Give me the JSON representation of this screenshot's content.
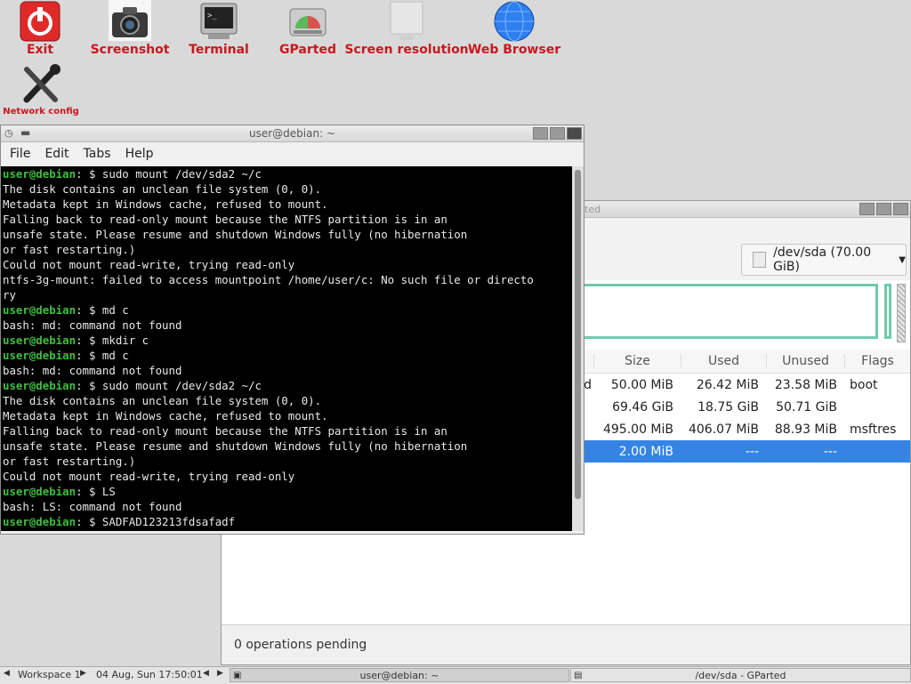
{
  "desktop": {
    "icons": [
      {
        "label": "Exit"
      },
      {
        "label": "Screenshot"
      },
      {
        "label": "Terminal"
      },
      {
        "label": "GParted"
      },
      {
        "label": "Screen resolution"
      },
      {
        "label": "Web Browser"
      },
      {
        "label": "Network config"
      }
    ]
  },
  "terminal": {
    "title": "user@debian: ~",
    "menu": [
      "File",
      "Edit",
      "Tabs",
      "Help"
    ],
    "prompt_user": "user@debian",
    "prompt_tail": ": $ ",
    "lines": [
      {
        "type": "cmd",
        "text": "sudo mount /dev/sda2 ~/c"
      },
      {
        "type": "out",
        "text": "The disk contains an unclean file system (0, 0)."
      },
      {
        "type": "out",
        "text": "Metadata kept in Windows cache, refused to mount."
      },
      {
        "type": "out",
        "text": "Falling back to read-only mount because the NTFS partition is in an"
      },
      {
        "type": "out",
        "text": "unsafe state. Please resume and shutdown Windows fully (no hibernation"
      },
      {
        "type": "out",
        "text": "or fast restarting.)"
      },
      {
        "type": "out",
        "text": "Could not mount read-write, trying read-only"
      },
      {
        "type": "out",
        "text": "ntfs-3g-mount: failed to access mountpoint /home/user/c: No such file or directo"
      },
      {
        "type": "out",
        "text": "ry"
      },
      {
        "type": "cmd",
        "text": "md c"
      },
      {
        "type": "out",
        "text": "bash: md: command not found"
      },
      {
        "type": "cmd",
        "text": "mkdir c"
      },
      {
        "type": "cmd",
        "text": "md c"
      },
      {
        "type": "out",
        "text": "bash: md: command not found"
      },
      {
        "type": "cmd",
        "text": "sudo mount /dev/sda2 ~/c"
      },
      {
        "type": "out",
        "text": "The disk contains an unclean file system (0, 0)."
      },
      {
        "type": "out",
        "text": "Metadata kept in Windows cache, refused to mount."
      },
      {
        "type": "out",
        "text": "Falling back to read-only mount because the NTFS partition is in an"
      },
      {
        "type": "out",
        "text": "unsafe state. Please resume and shutdown Windows fully (no hibernation"
      },
      {
        "type": "out",
        "text": "or fast restarting.)"
      },
      {
        "type": "out",
        "text": "Could not mount read-write, trying read-only"
      },
      {
        "type": "cmd",
        "text": "LS"
      },
      {
        "type": "out",
        "text": "bash: LS: command not found"
      },
      {
        "type": "cmd",
        "text": "SADFAD123213fdsafadf"
      }
    ]
  },
  "gparted": {
    "title_fragment": "ted",
    "device": "/dev/sda (70.00 GiB)",
    "columns": [
      "Size",
      "Used",
      "Unused",
      "Flags"
    ],
    "rows": [
      {
        "name_fragment": "d",
        "size": "50.00 MiB",
        "used": "26.42 MiB",
        "unused": "23.58 MiB",
        "flags": "boot",
        "selected": false
      },
      {
        "name_fragment": "",
        "size": "69.46 GiB",
        "used": "18.75 GiB",
        "unused": "50.71 GiB",
        "flags": "",
        "selected": false
      },
      {
        "name_fragment": "",
        "size": "495.00 MiB",
        "used": "406.07 MiB",
        "unused": "88.93 MiB",
        "flags": "msftres",
        "selected": false
      },
      {
        "name_fragment": "",
        "size": "2.00 MiB",
        "used": "---",
        "unused": "---",
        "flags": "",
        "selected": true
      }
    ],
    "status": "0 operations pending"
  },
  "taskbar": {
    "workspace": "Workspace 1",
    "datetime": "04 Aug, Sun 17:50:01",
    "task_terminal": "user@debian: ~",
    "task_gparted": "/dev/sda - GParted"
  },
  "colors": {
    "icon_label": "#c8181e",
    "prompt_green": "#3fbf3f",
    "selection_blue": "#3584e4",
    "partition_outline": "#6fcba9"
  }
}
